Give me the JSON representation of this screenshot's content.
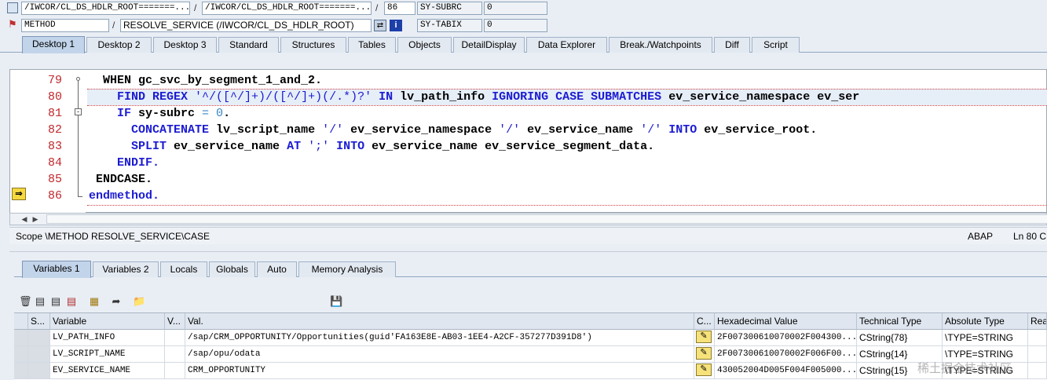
{
  "header": {
    "row1": {
      "program_field": "/IWCOR/CL_DS_HDLR_ROOT=======...",
      "include_field": "/IWCOR/CL_DS_HDLR_ROOT=======...",
      "line_field": "86",
      "sysvar_name": "SY-SUBRC",
      "sysvar_value": "0",
      "sep": "/"
    },
    "row2": {
      "type_field": "METHOD",
      "name_field": "RESOLVE_SERVICE (/IWCOR/CL_DS_HDLR_ROOT)",
      "sysvar_name": "SY-TABIX",
      "sysvar_value": "0",
      "sep": "/"
    }
  },
  "desktop_tabs": [
    {
      "label": "Desktop 1",
      "active": true
    },
    {
      "label": "Desktop 2"
    },
    {
      "label": "Desktop 3"
    },
    {
      "label": "Standard"
    },
    {
      "label": "Structures"
    },
    {
      "label": "Tables"
    },
    {
      "label": "Objects"
    },
    {
      "label": "DetailDisplay"
    },
    {
      "label": "Data Explorer"
    },
    {
      "label": "Break./Watchpoints"
    },
    {
      "label": "Diff"
    },
    {
      "label": "Script"
    }
  ],
  "code_lines": [
    {
      "num": "79",
      "indent": "  ",
      "parts": [
        {
          "t": "WHEN gc_svc_by_segment_1_and_2.",
          "c": ""
        }
      ]
    },
    {
      "num": "80",
      "indent": "    ",
      "parts": [
        {
          "t": "FIND REGEX ",
          "c": "kw"
        },
        {
          "t": "'^/([^/]+)/([^/]+)(/.*)?'",
          "c": "str"
        },
        {
          "t": " IN ",
          "c": "kw"
        },
        {
          "t": "lv_path_info ",
          "c": ""
        },
        {
          "t": "IGNORING CASE SUBMATCHES ",
          "c": "kw"
        },
        {
          "t": "ev_service_namespace ev_ser",
          "c": ""
        }
      ]
    },
    {
      "num": "81",
      "indent": "    ",
      "parts": [
        {
          "t": "IF ",
          "c": "kw"
        },
        {
          "t": "sy-subrc ",
          "c": ""
        },
        {
          "t": "= 0",
          "c": "num"
        },
        {
          "t": ".",
          "c": ""
        }
      ]
    },
    {
      "num": "82",
      "indent": "      ",
      "parts": [
        {
          "t": "CONCATENATE ",
          "c": "kw"
        },
        {
          "t": "lv_script_name ",
          "c": ""
        },
        {
          "t": "'/'",
          "c": "str"
        },
        {
          "t": " ev_service_namespace ",
          "c": ""
        },
        {
          "t": "'/'",
          "c": "str"
        },
        {
          "t": " ev_service_name ",
          "c": ""
        },
        {
          "t": "'/'",
          "c": "str"
        },
        {
          "t": " INTO ",
          "c": "kw"
        },
        {
          "t": "ev_service_root.",
          "c": ""
        }
      ]
    },
    {
      "num": "83",
      "indent": "      ",
      "parts": [
        {
          "t": "SPLIT ",
          "c": "kw"
        },
        {
          "t": "ev_service_name ",
          "c": ""
        },
        {
          "t": "AT ",
          "c": "kw"
        },
        {
          "t": "';'",
          "c": "str"
        },
        {
          "t": " INTO ",
          "c": "kw"
        },
        {
          "t": "ev_service_name ev_service_segment_data.",
          "c": ""
        }
      ]
    },
    {
      "num": "84",
      "indent": "    ",
      "parts": [
        {
          "t": "ENDIF.",
          "c": "kw"
        }
      ]
    },
    {
      "num": "85",
      "indent": " ",
      "parts": [
        {
          "t": "ENDCASE.",
          "c": ""
        }
      ]
    },
    {
      "num": "86",
      "indent": "",
      "parts": [
        {
          "t": "endmethod.",
          "c": "kw"
        }
      ]
    }
  ],
  "status_bar": {
    "scope": "Scope \\METHOD RESOLVE_SERVICE\\CASE",
    "language": "ABAP",
    "position": "Ln  80 C"
  },
  "variable_tabs": [
    {
      "label": "Variables 1",
      "active": true
    },
    {
      "label": "Variables 2"
    },
    {
      "label": "Locals"
    },
    {
      "label": "Globals"
    },
    {
      "label": "Auto"
    },
    {
      "label": "Memory Analysis"
    }
  ],
  "grid": {
    "headers": [
      "S...",
      "Variable",
      "V...",
      "Val.",
      "C...",
      "Hexadecimal Value",
      "Technical Type",
      "Absolute Type",
      "Rea"
    ],
    "rows": [
      {
        "variable": "LV_PATH_INFO",
        "value": "/sap/CRM_OPPORTUNITY/Opportunities(guid'FA163E8E-AB03-1EE4-A2CF-357277D391D8')",
        "hex": "2F007300610070002F004300...",
        "tech_type": "CString{78}",
        "abs_type": "\\TYPE=STRING"
      },
      {
        "variable": "LV_SCRIPT_NAME",
        "value": "/sap/opu/odata",
        "hex": "2F007300610070002F006F00...",
        "tech_type": "CString{14}",
        "abs_type": "\\TYPE=STRING"
      },
      {
        "variable": "EV_SERVICE_NAME",
        "value": "CRM_OPPORTUNITY",
        "hex": "430052004D005F004F005000...",
        "tech_type": "CString{15}",
        "abs_type": "\\TYPE=STRING"
      }
    ]
  },
  "watermark": "稀土掘金技术社区"
}
